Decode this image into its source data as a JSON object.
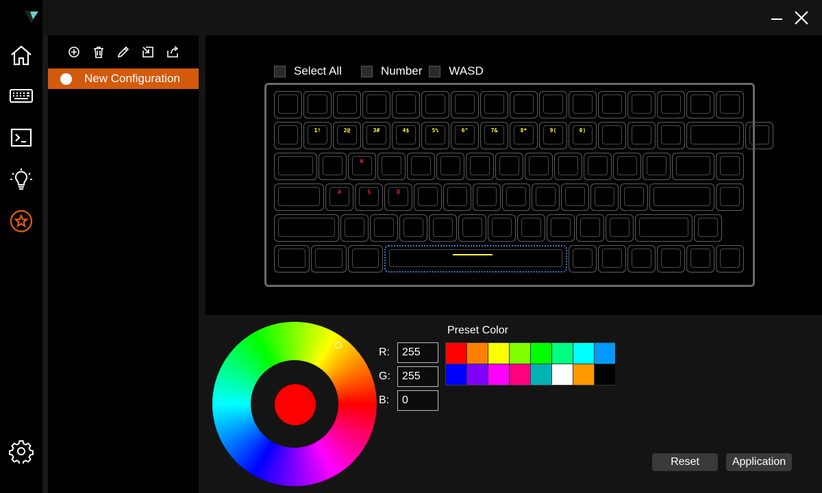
{
  "rail": {
    "items": [
      {
        "name": "home-icon"
      },
      {
        "name": "keyboard-icon"
      },
      {
        "name": "terminal-icon"
      },
      {
        "name": "lightbulb-icon"
      },
      {
        "name": "star-badge-icon"
      }
    ],
    "settings_icon": "gear-icon"
  },
  "config": {
    "toolbar": [
      "add-icon",
      "delete-icon",
      "edit-icon",
      "import-icon",
      "export-icon"
    ],
    "items": [
      {
        "label": "New Configuration"
      }
    ]
  },
  "main": {
    "select": {
      "select_all": "Select All",
      "number": "Number",
      "wasd": "WASD"
    },
    "keyboard": {
      "number_legends": [
        "1!",
        "2@",
        "3#",
        "4$",
        "5%",
        "6^",
        "7&",
        "8*",
        "9(",
        "0)"
      ],
      "wasd_legends": [
        "W",
        "A",
        "S",
        "D"
      ]
    }
  },
  "color": {
    "r_label": "R:",
    "g_label": "G:",
    "b_label": "B:",
    "r_value": "255",
    "g_value": "255",
    "b_value": "0",
    "preview_color": "#ff0000",
    "preset_title": "Preset Color",
    "presets": [
      "#ff0000",
      "#ff8000",
      "#ffff00",
      "#80ff00",
      "#00ff00",
      "#00ff80",
      "#00ffff",
      "#0099ff",
      "#0000ff",
      "#8000ff",
      "#ff00ff",
      "#ff0080",
      "#00b3b3",
      "#ffffff",
      "#ff9900",
      "#000000"
    ],
    "reset": "Reset",
    "apply": "Application"
  },
  "accent": "#d45a0c"
}
